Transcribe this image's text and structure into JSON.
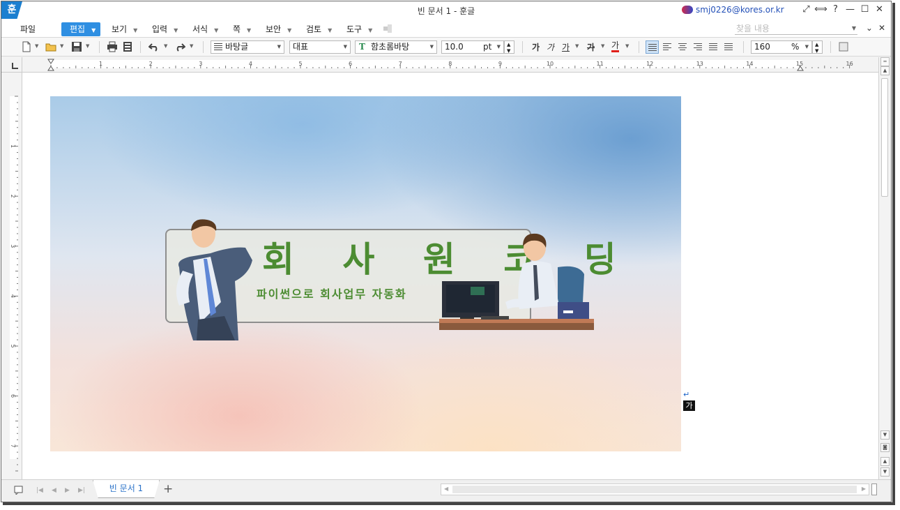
{
  "window": {
    "app_icon": "훈",
    "title": "빈 문서 1 - 훈글",
    "account": "smj0226@kores.or.kr",
    "controls": [
      "⤢",
      "⟺",
      "?",
      "—",
      "☐",
      "✕"
    ]
  },
  "menu": {
    "file": "파일",
    "items": [
      "편집",
      "보기",
      "입력",
      "서식",
      "쪽",
      "보안",
      "검토",
      "도구"
    ],
    "find_placeholder": "찾을 내용",
    "right": [
      "⌄",
      "✕"
    ]
  },
  "toolbar": {
    "style": "바탕글",
    "language": "대표",
    "font": "함초롬바탕",
    "font_size": "10.0",
    "font_unit": "pt",
    "fmt_bold": "가",
    "fmt_italic": "가",
    "fmt_underline": "가",
    "fmt_strike": "가",
    "fmt_color": "가",
    "zoom": "160",
    "zoom_unit": "%"
  },
  "ruler": {
    "h_labels": [
      "1",
      "2",
      "3",
      "4",
      "5",
      "6",
      "7",
      "8",
      "9",
      "10",
      "11",
      "12",
      "13",
      "14",
      "15",
      "16"
    ],
    "v_labels": [
      "1",
      "2",
      "3",
      "4",
      "5",
      "6",
      "7"
    ]
  },
  "document": {
    "banner_title": "회 사 원 코 딩",
    "banner_subtitle": "파이썬으로 회사업무 자동화",
    "para_mark": "↵",
    "caret_char": "가"
  },
  "statusbar": {
    "tab_label": "빈 문서 1",
    "add_tab": "+"
  },
  "colors": {
    "accent": "#2f8fe2",
    "banner_text": "#4c8c32",
    "tab_text": "#2a72c8"
  }
}
